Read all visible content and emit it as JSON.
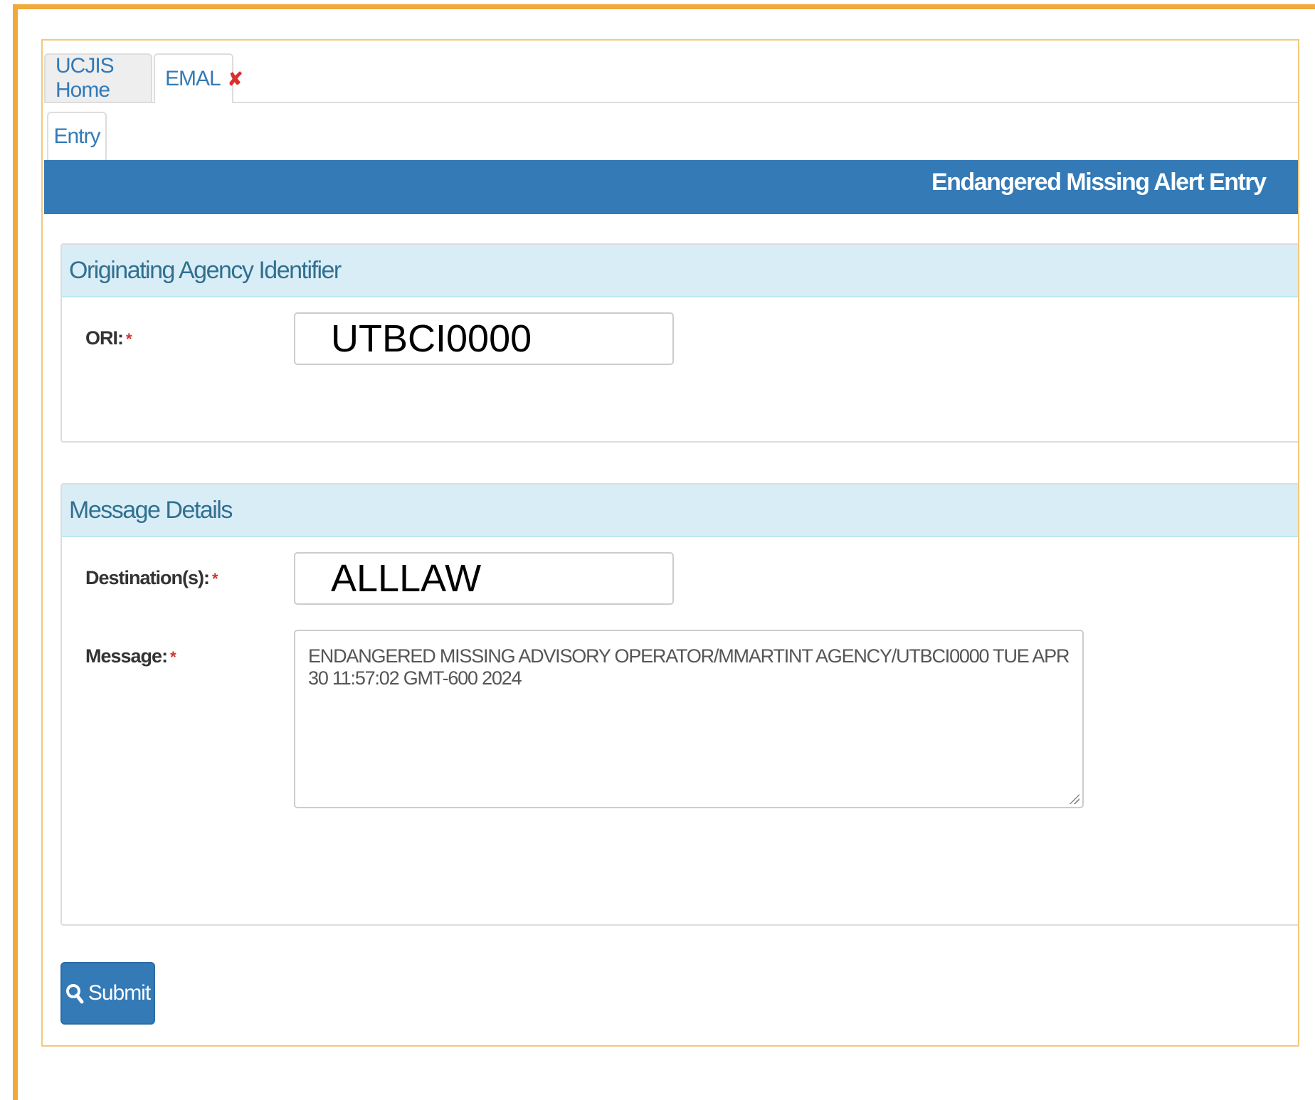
{
  "tabs": {
    "home_label": "UCJIS Home",
    "emal_label": "EMAL",
    "close_glyph": "✘",
    "entry_label": "Entry"
  },
  "header": {
    "title": "Endangered Missing Alert Entry"
  },
  "ori_panel": {
    "heading": "Originating Agency Identifier",
    "ori_label": "ORI:",
    "ori_value": "UTBCI0000"
  },
  "message_panel": {
    "heading": "Message Details",
    "destination_label": "Destination(s):",
    "destination_value": "ALLLAW",
    "message_label": "Message:",
    "message_value": "ENDANGERED MISSING ADVISORY OPERATOR/MMARTINT AGENCY/UTBCI0000 TUE APR 30 11:57:02 GMT-600 2024"
  },
  "required_marker": "*",
  "submit": {
    "label": "Submit",
    "icon": "search-icon"
  },
  "colors": {
    "frame_accent": "#f0a93b",
    "primary": "#337ab7",
    "panel_heading_bg": "#d9edf7",
    "panel_heading_text": "#31708f",
    "required": "#d9302c"
  }
}
